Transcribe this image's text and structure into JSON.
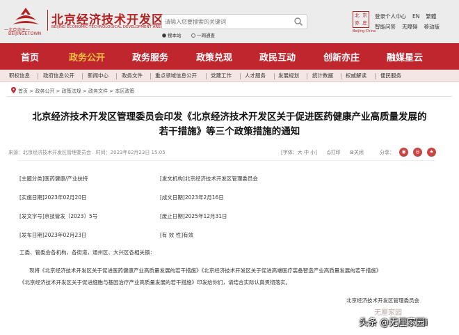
{
  "header": {
    "logo_sub": "一北京亦庄一",
    "logo_sub_en": "BEIJINGETOWN",
    "site_title": "北京经济技术开发区",
    "site_title_en": "BEIJING ECONOMIC-TECHNOLOGICAL DEVELOPMENT AREA",
    "search_placeholder": "请输入您要搜索的关键词",
    "scope_site": "搜本站",
    "scope_network": "一网通查",
    "gov_badge": [
      "北",
      "京",
      "亦",
      "庄"
    ],
    "gov_city": "Beijing-China",
    "top_row1": [
      "登录个人中心",
      "EN",
      "繁體"
    ],
    "top_row2": [
      "智能问答",
      "无障碍",
      "移动版"
    ]
  },
  "main_nav": {
    "items": [
      "首页",
      "政务公开",
      "政务服务",
      "政策兑现",
      "政民互动",
      "创新亦庄",
      "融媒星云"
    ],
    "active_index": 1
  },
  "sub_nav": {
    "items": [
      "职权信息",
      "政府信息公开",
      "新闻中心",
      "政务文件",
      "重点领域信息公开",
      "党建工作",
      "人才服务",
      "发展规划",
      "统计数据",
      "权威解读",
      "便民服务"
    ]
  },
  "breadcrumb": {
    "items": [
      "首页",
      "政务公开",
      "政策法规",
      "政务文件",
      "本区政策"
    ],
    "separator": " > "
  },
  "article": {
    "title_line1": "北京经济技术开发区管理委员会印发《北京经济技术开发区关于促进医药健康产业高质量发展的",
    "title_line2": "若干措施》等三个政策措施的通知",
    "source": "来源：北京经济技术开发区管理委员会",
    "time": "时间：2023年02月23日 15:05",
    "font_size_label": "[字体：大 中 小]",
    "print_label": "打印",
    "close_label": "关闭",
    "share_label": "分享："
  },
  "info_table": {
    "theme": "[主题分类]医药健康/产业扶持",
    "issuer": "[发文机构]北京经济技术开发区管理委员会",
    "implement_date": "[实施日期]2023年02月20日",
    "written_date": "[成文日期]2023年2月16日",
    "doc_number": "[发文字号]京技管发〔2023〕5号",
    "expiry_date": "[废止日期]2025年12月31日",
    "publish_date": "[发布日期]2023年02月23日",
    "validity": "[有 效 性]有效"
  },
  "body": {
    "salutation": "工委、管委会各机构，各街道，通州区、大兴区各相关镇：",
    "para_line1": "现将《北京经济技术开发区关于促进医药健康产业高质量发展的若干措施》《北京经济技术开发区关于促进高端医疗装备智造产业高质量发展的若干措施》",
    "para_line2": "《北京经济技术开发区关于促进细胞与基因治疗产业高质量发展的若干措施》印发给你们，请结合实际认真贯彻落实。",
    "signature": "北京经济技术开发区管理委员会"
  },
  "watermark": {
    "top": "无厘家园",
    "bottom": "头条 @无厘家园i"
  },
  "colors": {
    "brand_red": "#c0262d",
    "active_nav": "#f5c142",
    "subnav_bg": "#f4e7e3",
    "header_bg": "#ececec"
  }
}
